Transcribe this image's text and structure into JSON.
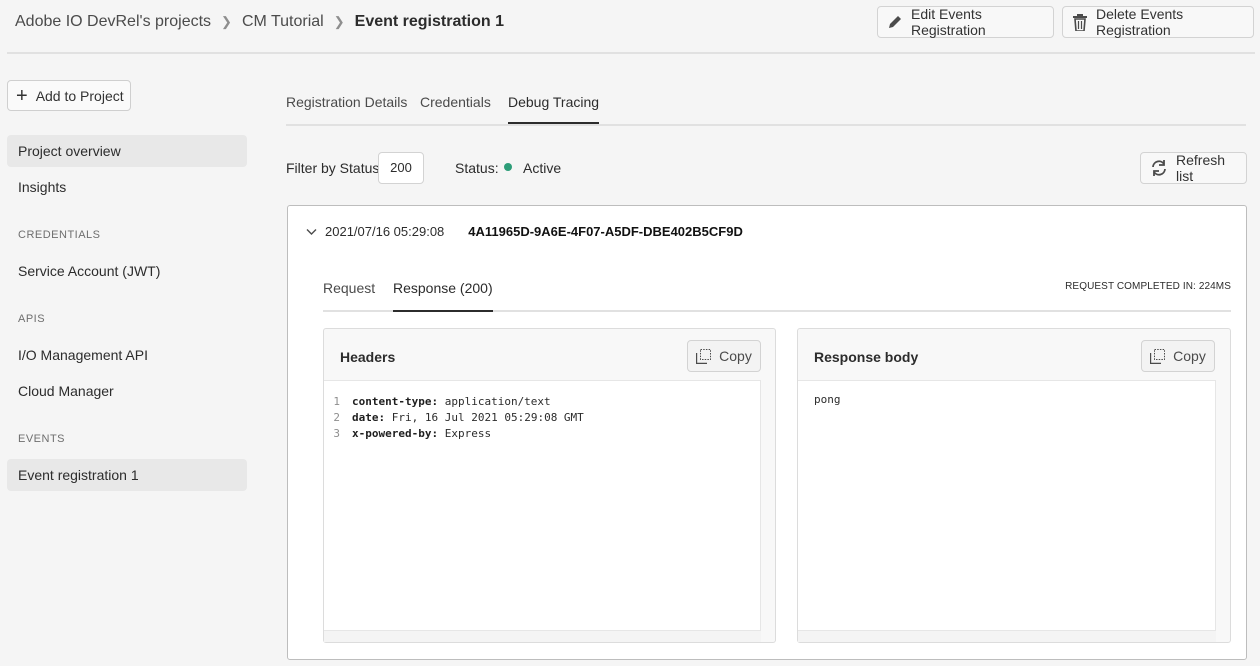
{
  "breadcrumb": {
    "items": [
      "Adobe IO DevRel's projects",
      "CM Tutorial"
    ],
    "current": "Event registration 1"
  },
  "header_actions": {
    "edit_label": "Edit Events Registration",
    "delete_label": "Delete Events Registration"
  },
  "sidebar": {
    "add_label": "Add to Project",
    "overview": "Project overview",
    "insights": "Insights",
    "credentials_heading": "CREDENTIALS",
    "credentials": [
      "Service Account (JWT)"
    ],
    "apis_heading": "APIS",
    "apis": [
      "I/O Management API",
      "Cloud Manager"
    ],
    "events_heading": "EVENTS",
    "events": [
      "Event registration 1"
    ]
  },
  "tabs": [
    "Registration Details",
    "Credentials",
    "Debug Tracing"
  ],
  "filter": {
    "label": "Filter by Status:",
    "value": "200",
    "status_label": "Status:",
    "status_value": "Active",
    "status_color": "#2d9d78",
    "refresh_label": "Refresh list"
  },
  "trace": {
    "timestamp": "2021/07/16 05:29:08",
    "id": "4A11965D-9A6E-4F07-A5DF-DBE402B5CF9D",
    "tabs": [
      "Request",
      "Response (200)"
    ],
    "completed": "REQUEST COMPLETED IN: 224MS",
    "headers_title": "Headers",
    "copy_label": "Copy",
    "headers": [
      {
        "n": "1",
        "key": "content-type:",
        "value": " application/text"
      },
      {
        "n": "2",
        "key": "date:",
        "value": " Fri, 16 Jul 2021 05:29:08 GMT"
      },
      {
        "n": "3",
        "key": "x-powered-by:",
        "value": " Express"
      }
    ],
    "body_title": "Response body",
    "body": "pong"
  }
}
